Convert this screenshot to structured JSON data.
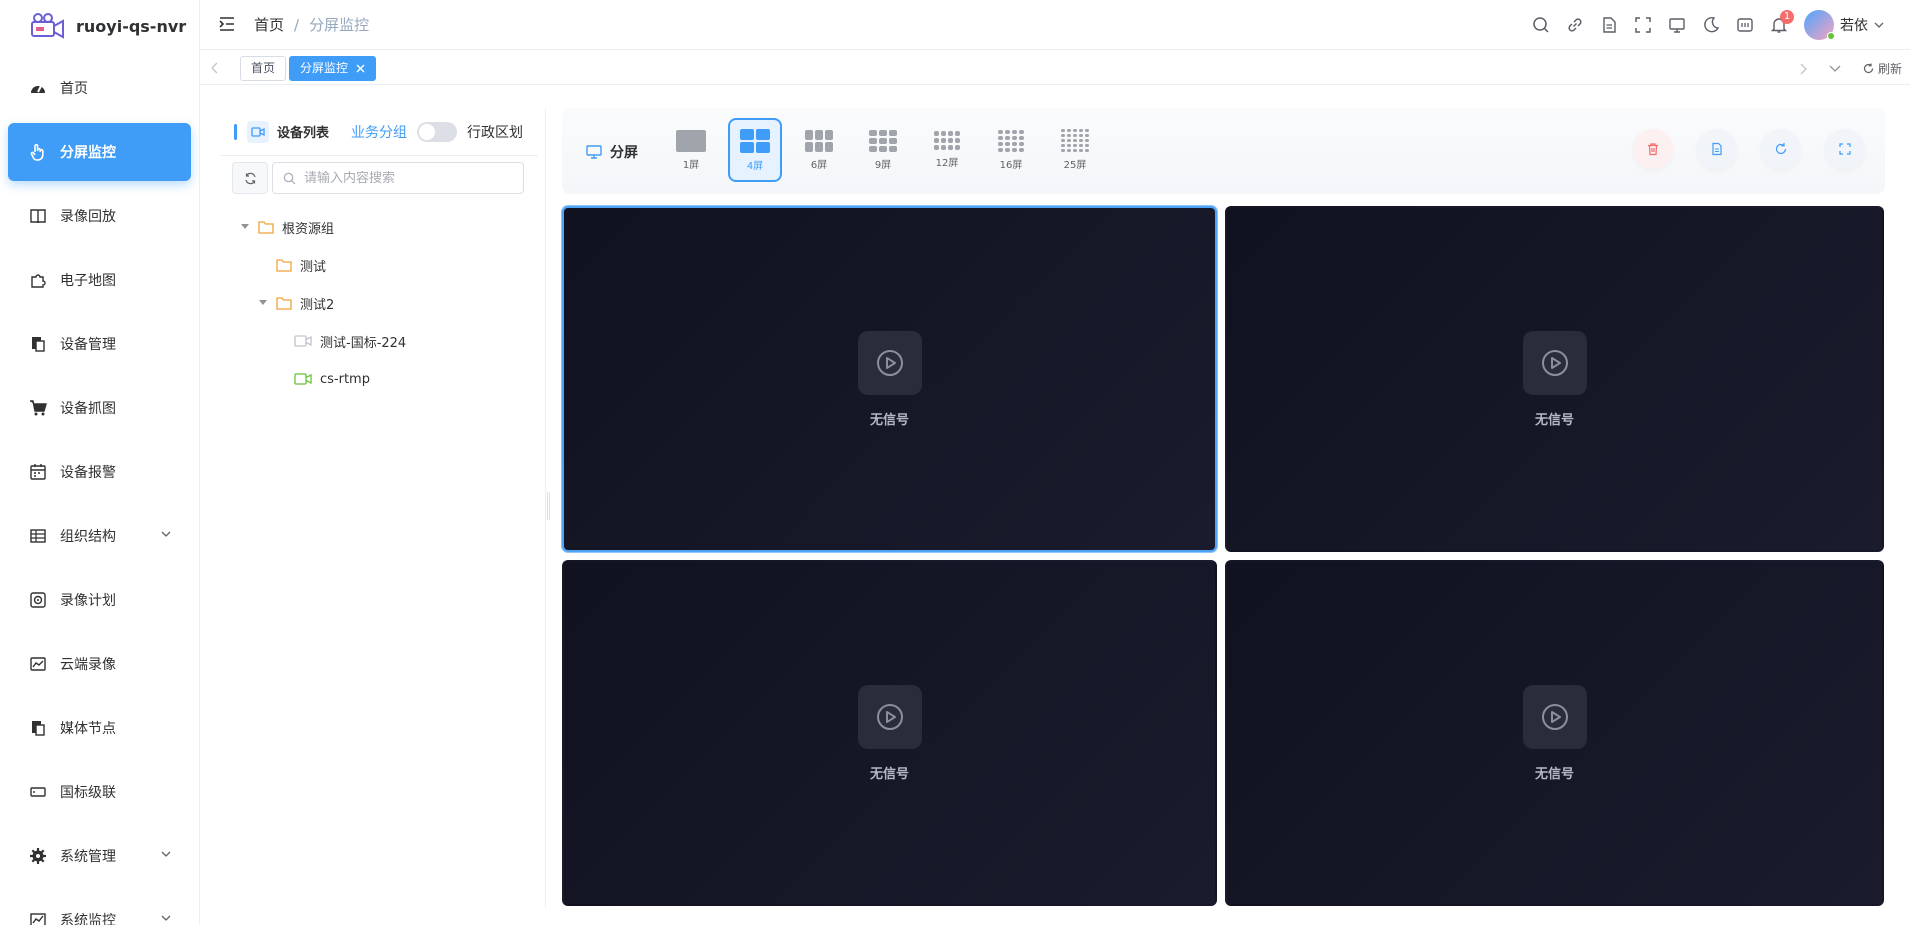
{
  "app": {
    "name": "ruoyi-qs-nvr"
  },
  "sidebar": {
    "items": [
      {
        "label": "首页",
        "icon": "dashboard-icon"
      },
      {
        "label": "分屏监控",
        "icon": "hand-icon",
        "active": true
      },
      {
        "label": "录像回放",
        "icon": "book-icon"
      },
      {
        "label": "电子地图",
        "icon": "puzzle-icon"
      },
      {
        "label": "设备管理",
        "icon": "documents-icon"
      },
      {
        "label": "设备抓图",
        "icon": "cart-icon"
      },
      {
        "label": "设备报警",
        "icon": "calendar-icon"
      },
      {
        "label": "组织结构",
        "icon": "table-icon",
        "expandable": true
      },
      {
        "label": "录像计划",
        "icon": "plan-icon"
      },
      {
        "label": "云端录像",
        "icon": "chart-icon"
      },
      {
        "label": "媒体节点",
        "icon": "documents-icon"
      },
      {
        "label": "国标级联",
        "icon": "input-icon"
      },
      {
        "label": "系统管理",
        "icon": "gear-icon",
        "expandable": true
      },
      {
        "label": "系统监控",
        "icon": "monitor-chart-icon",
        "expandable": true
      }
    ]
  },
  "breadcrumb": {
    "home": "首页",
    "separator": "/",
    "current": "分屏监控"
  },
  "navbar": {
    "badge_count": "1",
    "user": "若依"
  },
  "tags": {
    "home": "首页",
    "active": "分屏监控",
    "refresh": "刷新"
  },
  "tree_panel": {
    "device_list": "设备列表",
    "business_group": "业务分组",
    "admin_region": "行政区划",
    "search_placeholder": "请输入内容搜索",
    "nodes": [
      {
        "label": "根资源组",
        "type": "folder",
        "level": 0,
        "expanded": true
      },
      {
        "label": "测试",
        "type": "folder",
        "level": 1
      },
      {
        "label": "测试2",
        "type": "folder",
        "level": 1,
        "expanded": true
      },
      {
        "label": "测试-国标-224",
        "type": "camera-offline",
        "level": 2
      },
      {
        "label": "cs-rtmp",
        "type": "camera-online",
        "level": 2
      }
    ]
  },
  "split": {
    "label": "分屏",
    "layouts": [
      "1屏",
      "4屏",
      "6屏",
      "9屏",
      "12屏",
      "16屏",
      "25屏"
    ],
    "selected": "4屏"
  },
  "video": {
    "no_signal": "无信号"
  },
  "colors": {
    "accent": "#3f9cf7",
    "video_bg": "#141626",
    "danger": "#f56c6c",
    "online": "#67c23a"
  }
}
